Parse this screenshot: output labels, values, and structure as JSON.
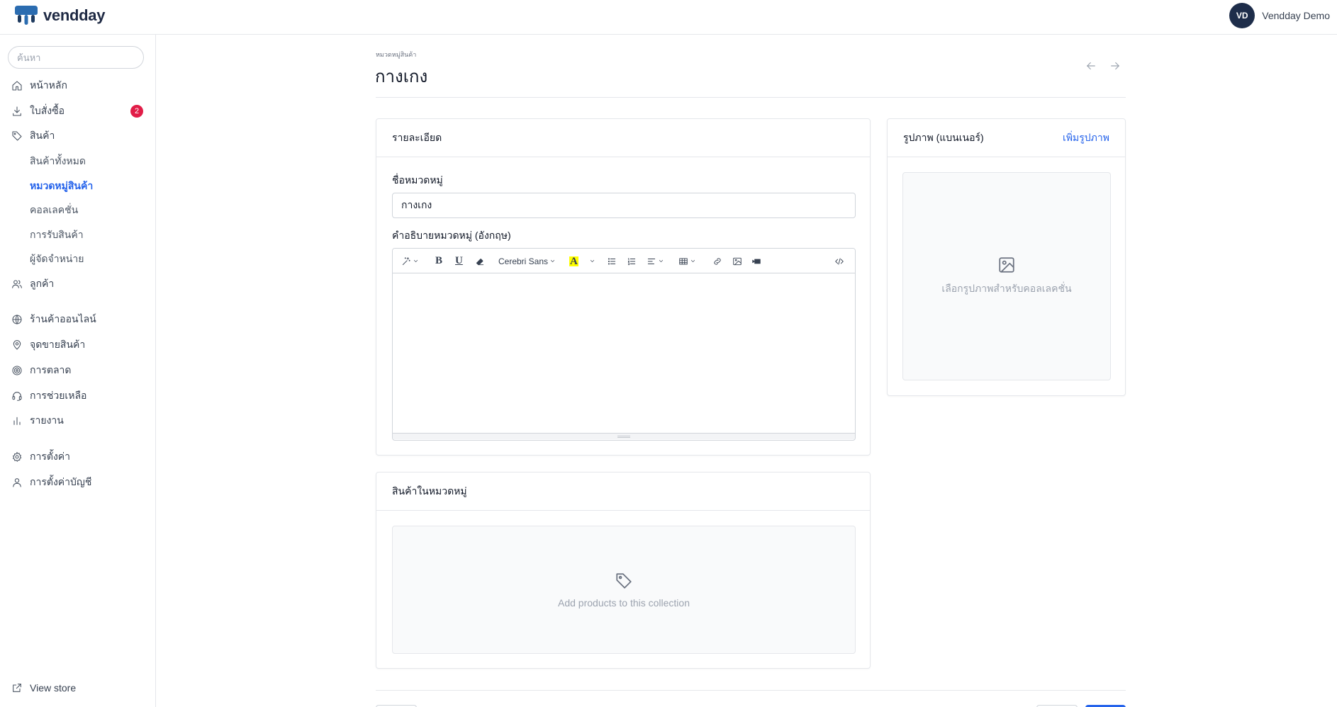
{
  "app": {
    "brand": "vendday"
  },
  "user": {
    "initials": "VD",
    "name": "Vendday Demo"
  },
  "search": {
    "placeholder": "ค้นหา"
  },
  "sidebar": {
    "items": [
      {
        "label": "หน้าหลัก",
        "icon": "home-icon"
      },
      {
        "label": "ใบสั่งซื้อ",
        "icon": "download-icon",
        "badge": "2"
      },
      {
        "label": "สินค้า",
        "icon": "tag-icon"
      },
      {
        "label": "ลูกค้า",
        "icon": "users-icon"
      },
      {
        "label": "ร้านค้าออนไลน์",
        "icon": "globe-icon"
      },
      {
        "label": "จุดขายสินค้า",
        "icon": "map-pin-icon"
      },
      {
        "label": "การตลาด",
        "icon": "target-icon"
      },
      {
        "label": "การช่วยเหลือ",
        "icon": "headset-icon"
      },
      {
        "label": "รายงาน",
        "icon": "bar-chart-icon"
      },
      {
        "label": "การตั้งค่า",
        "icon": "gear-icon"
      },
      {
        "label": "การตั้งค่าบัญชี",
        "icon": "user-icon"
      }
    ],
    "product_sub": [
      {
        "label": "สินค้าทั้งหมด"
      },
      {
        "label": "หมวดหมู่สินค้า",
        "active": true
      },
      {
        "label": "คอลเลคชั่น"
      },
      {
        "label": "การรับสินค้า"
      },
      {
        "label": "ผู้จัดจำหน่าย"
      }
    ],
    "view_store": "View store"
  },
  "page": {
    "breadcrumb": "หมวดหมู่สินค้า",
    "title": "กางเกง"
  },
  "details_card": {
    "title": "รายละเอียด",
    "name_label": "ชื่อหมวดหมู่",
    "name_value": "กางเกง",
    "description_label": "คำอธิบายหมวดหมู่ (อังกฤษ)",
    "font_name": "Cerebri Sans"
  },
  "image_card": {
    "title": "รูปภาพ (แบนเนอร์)",
    "add_link": "เพิ่มรูปภาพ",
    "placeholder": "เลือกรูปภาพสำหรับคอลเลคชั่น"
  },
  "products_card": {
    "title": "สินค้าในหมวดหมู่",
    "empty_text": "Add products to this collection"
  },
  "colors": {
    "accent": "#2563eb",
    "badge": "#e11d48",
    "avatar": "#1e2d4a"
  }
}
